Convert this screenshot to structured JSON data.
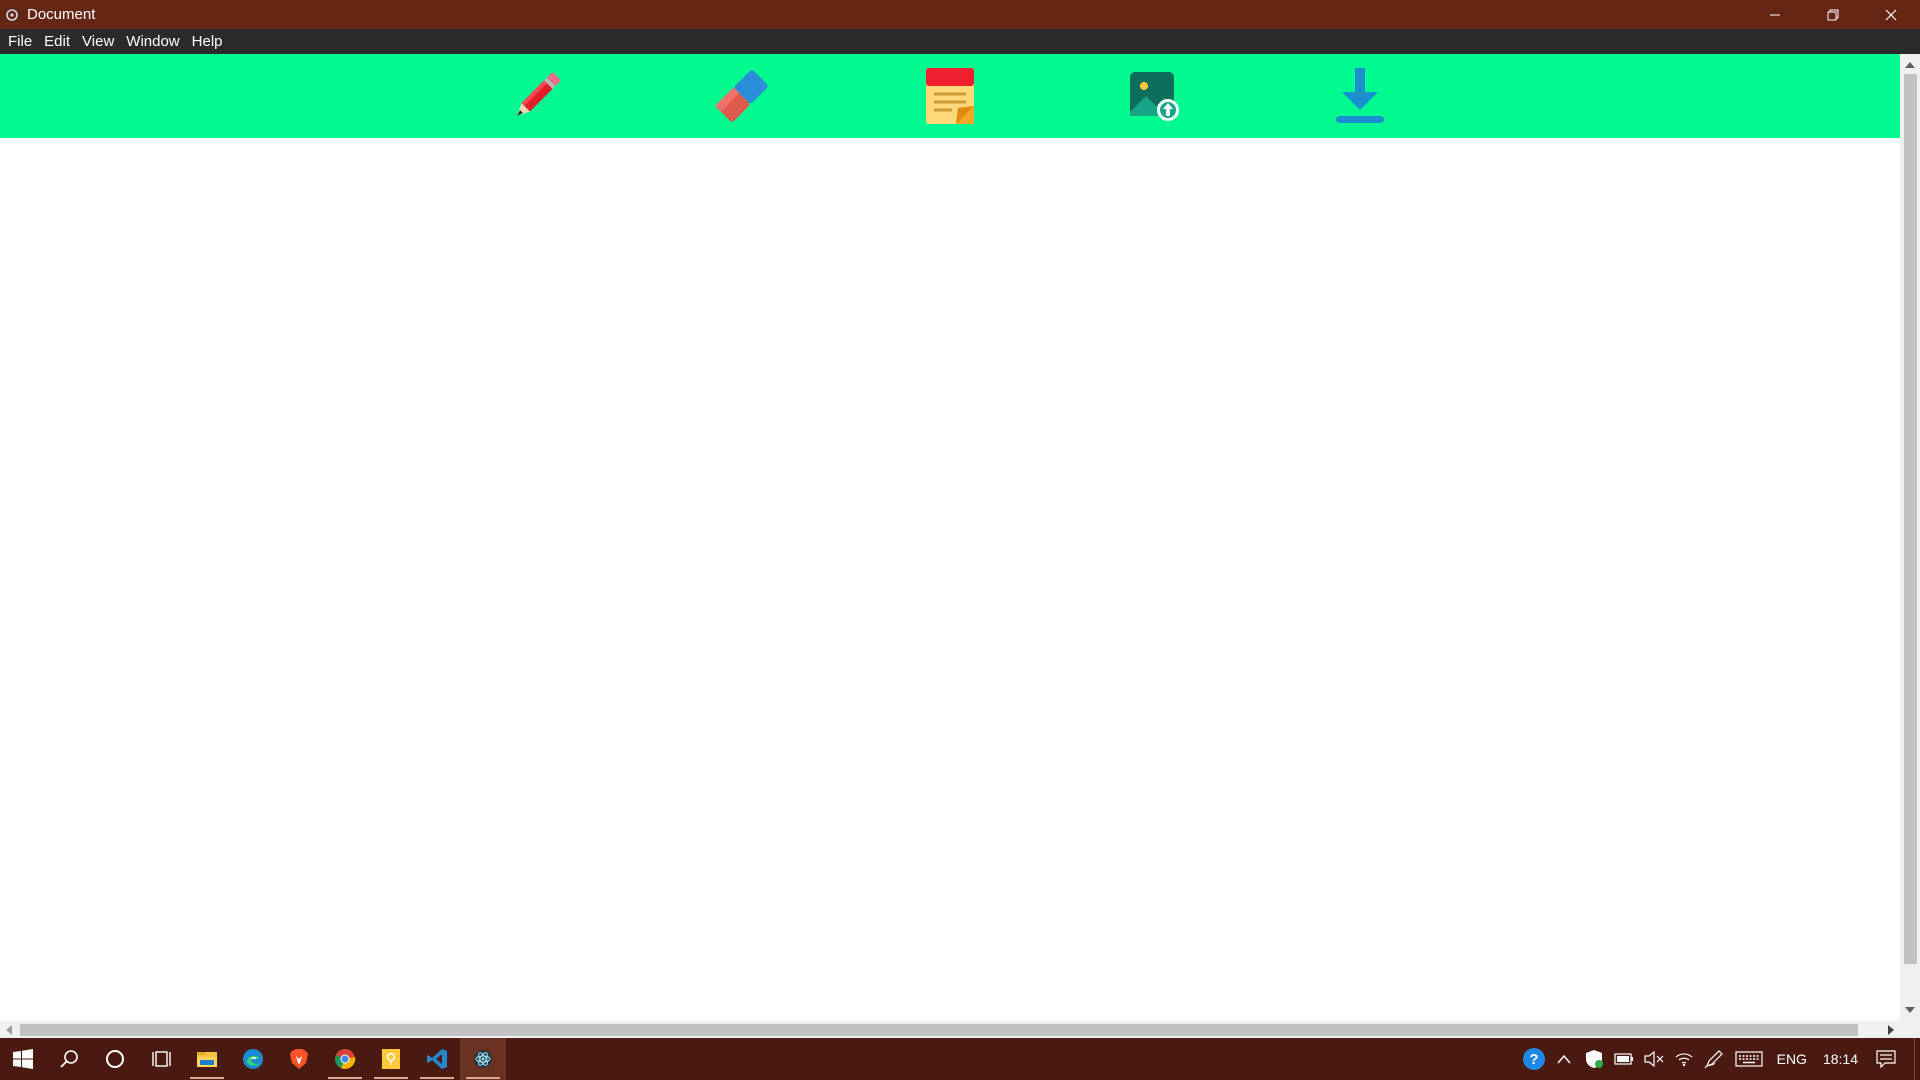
{
  "window": {
    "title": "Document",
    "controls": [
      "minimize-icon",
      "restore-icon",
      "close-icon"
    ]
  },
  "menu": {
    "items": [
      "File",
      "Edit",
      "View",
      "Window",
      "Help"
    ]
  },
  "toolbar": {
    "background": "#00fa90",
    "tools": [
      "pencil-icon",
      "eraser-icon",
      "notes-icon",
      "image-upload-icon",
      "download-icon"
    ]
  },
  "taskbar": {
    "apps": [
      "windows-start-icon",
      "search-icon",
      "cortana-icon",
      "task-view-icon",
      "file-explorer-icon",
      "edge-icon",
      "brave-icon",
      "chrome-icon",
      "sticky-notes-icon",
      "vscode-icon",
      "electron-app-icon"
    ],
    "tray": {
      "language": "ENG",
      "time": "18:14"
    }
  },
  "colors": {
    "titlebar": "#652614",
    "menubar": "#2b2b2d",
    "taskbar": "#4a1a10"
  }
}
